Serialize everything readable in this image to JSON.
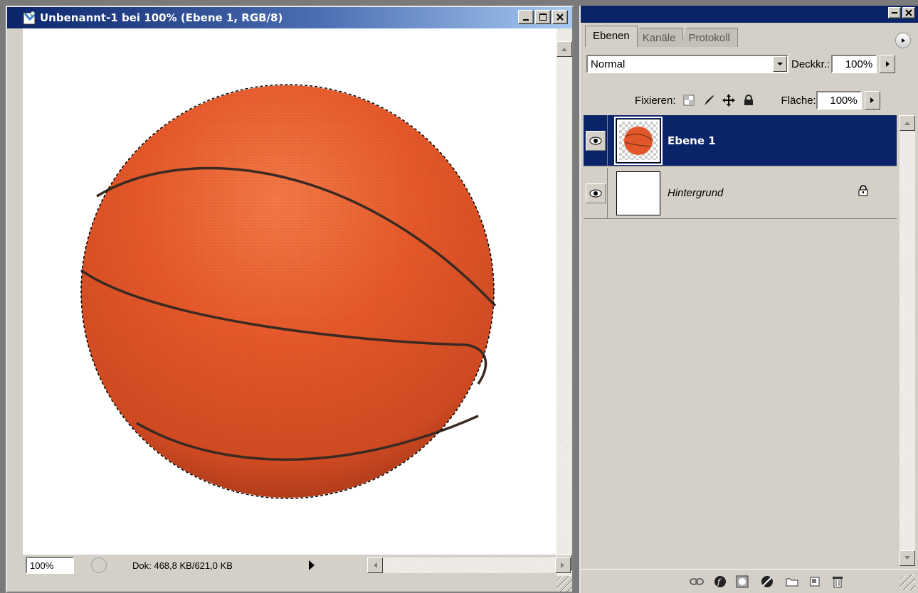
{
  "document": {
    "title": "Unbenannt-1 bei 100% (Ebene 1, RGB/8)",
    "zoom": "100%",
    "doc_info": "Dok: 468,8 KB/621,0 KB"
  },
  "panel": {
    "tabs": [
      {
        "label": "Ebenen",
        "active": true
      },
      {
        "label": "Kanäle",
        "active": false
      },
      {
        "label": "Protokoll",
        "active": false
      }
    ],
    "blend_mode": "Normal",
    "opacity_label": "Deckkr.:",
    "opacity_value": "100%",
    "lock_label": "Fixieren:",
    "fill_label": "Fläche:",
    "fill_value": "100%",
    "layers": [
      {
        "name": "Ebene 1",
        "selected": true,
        "visible": true
      },
      {
        "name": "Hintergrund",
        "selected": false,
        "visible": true,
        "locked": true
      }
    ]
  },
  "colors": {
    "title_bar": "#0a246a",
    "selection": "#0a246a",
    "chrome": "#d4d0c8",
    "ball": "#e2572a"
  }
}
